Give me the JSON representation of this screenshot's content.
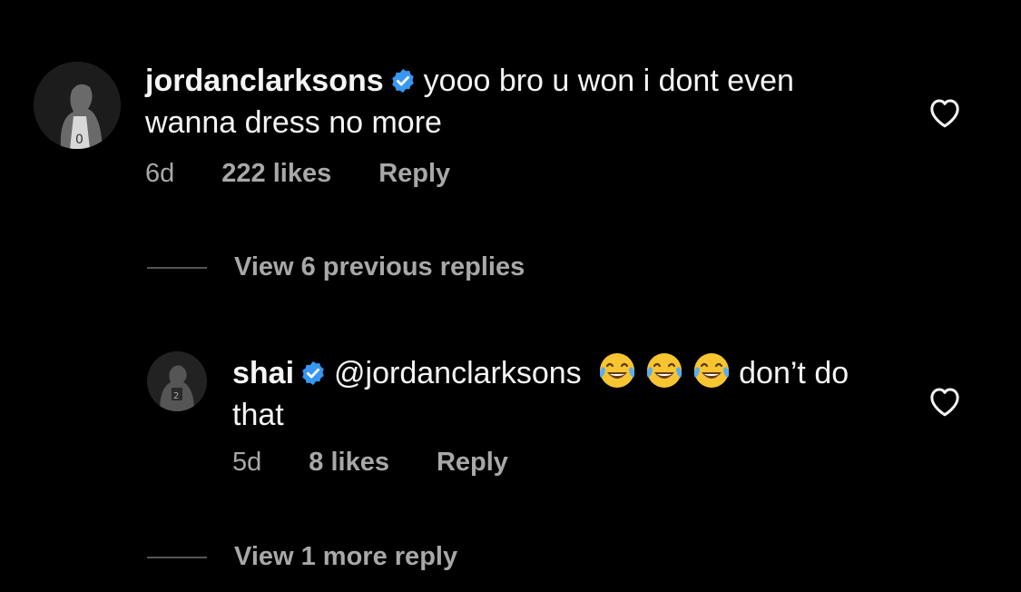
{
  "comments": [
    {
      "username": "jordanclarksons",
      "text": "yooo bro u won i dont even wanna dress no more",
      "time": "6d",
      "likes": "222 likes",
      "reply": "Reply"
    },
    {
      "username": "shai",
      "mention": "@jordanclarksons",
      "emojis": [
        "face-with-tears-of-joy",
        "face-with-tears-of-joy",
        "face-with-tears-of-joy"
      ],
      "text": "don’t do that",
      "time": "5d",
      "likes": "8 likes",
      "reply": "Reply"
    }
  ],
  "threads": [
    {
      "label": "View 6 previous replies"
    },
    {
      "label": "View 1 more reply"
    }
  ],
  "icons": {
    "verified": "verified-badge-icon",
    "like": "heart-outline-icon"
  },
  "colors": {
    "background": "#000000",
    "text": "#f5f5f5",
    "muted": "#a8a8a8",
    "verified": "#3897f0"
  }
}
